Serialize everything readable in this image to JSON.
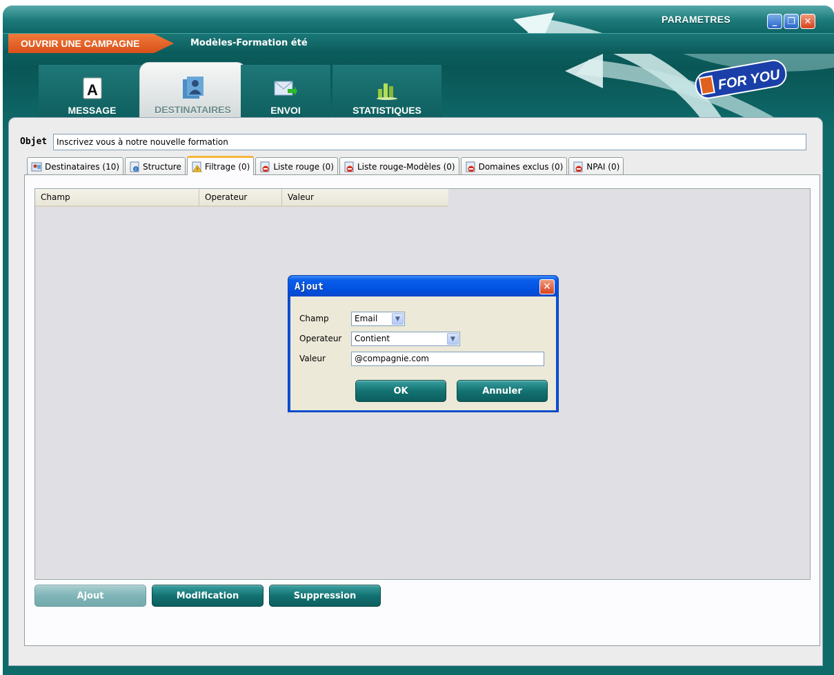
{
  "window": {
    "params_label": "PARAMETRES",
    "min_glyph": "_",
    "max_glyph": "❐",
    "close_glyph": "✕"
  },
  "campaign": {
    "open_label": "OUVRIR UNE CAMPAGNE",
    "name": "Modèles-Formation été"
  },
  "logo": {
    "text": "FOR YOU"
  },
  "main_tabs": [
    {
      "label": "MESSAGE",
      "icon": "letter-a-icon"
    },
    {
      "label": "DESTINATAIRES",
      "icon": "contacts-icon"
    },
    {
      "label": "ENVOI",
      "icon": "send-mail-icon"
    },
    {
      "label": "STATISTIQUES",
      "icon": "stats-chart-icon"
    }
  ],
  "objet": {
    "label": "Objet",
    "value": "Inscrivez vous à notre nouvelle formation"
  },
  "sub_tabs": [
    {
      "label": "Destinataires (10)",
      "icon": "recipients-icon"
    },
    {
      "label": "Structure",
      "icon": "structure-icon"
    },
    {
      "label": "Filtrage (0)",
      "icon": "filter-warning-icon"
    },
    {
      "label": "Liste rouge (0)",
      "icon": "blocked-list-icon"
    },
    {
      "label": "Liste rouge-Modèles (0)",
      "icon": "blocked-list-icon"
    },
    {
      "label": "Domaines exclus (0)",
      "icon": "blocked-list-icon"
    },
    {
      "label": "NPAI (0)",
      "icon": "blocked-list-icon"
    }
  ],
  "grid": {
    "columns": [
      "Champ",
      "Operateur",
      "Valeur"
    ]
  },
  "buttons": {
    "add": "Ajout",
    "modify": "Modification",
    "delete": "Suppression"
  },
  "dialog": {
    "title": "Ajout",
    "close_glyph": "✕",
    "champ_label": "Champ",
    "champ_value": "Email",
    "operateur_label": "Operateur",
    "operateur_value": "Contient",
    "valeur_label": "Valeur",
    "valeur_value": "@compagnie.com",
    "ok_label": "OK",
    "cancel_label": "Annuler"
  },
  "colors": {
    "teal_primary": "#0f6b6b",
    "orange_accent": "#e0601e",
    "dialog_blue": "#0050e0"
  }
}
